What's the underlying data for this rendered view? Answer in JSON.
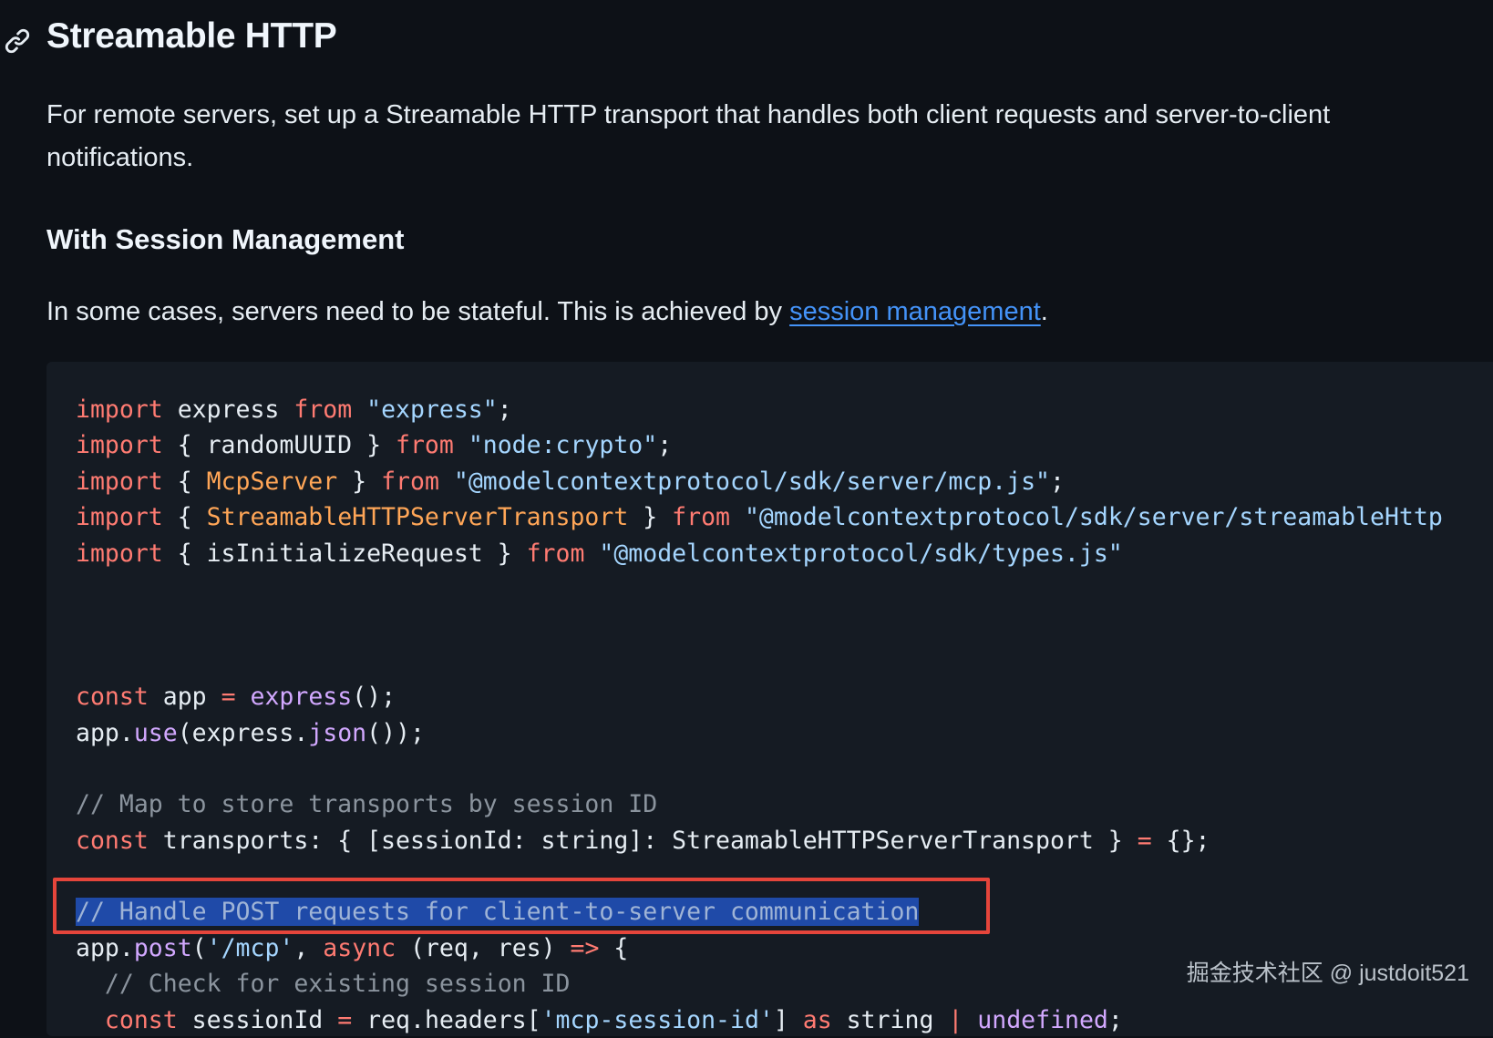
{
  "heading": "Streamable HTTP",
  "intro_line1": "For remote servers, set up a Streamable HTTP transport that handles both client requests and server-to-client",
  "intro_line2": "notifications.",
  "subheading": "With Session Management",
  "session_text_before": "In some cases, servers need to be stateful. This is achieved by ",
  "session_link": "session management",
  "session_text_after": ".",
  "code_lines": [
    [
      [
        "kw",
        "import"
      ],
      [
        "p",
        " express "
      ],
      [
        "kw",
        "from"
      ],
      [
        "p",
        " "
      ],
      [
        "str",
        "\"express\""
      ],
      [
        "p",
        ";"
      ]
    ],
    [
      [
        "kw",
        "import"
      ],
      [
        "p",
        " { randomUUID } "
      ],
      [
        "kw",
        "from"
      ],
      [
        "p",
        " "
      ],
      [
        "str",
        "\"node:crypto\""
      ],
      [
        "p",
        ";"
      ]
    ],
    [
      [
        "kw",
        "import"
      ],
      [
        "p",
        " { "
      ],
      [
        "cls",
        "McpServer"
      ],
      [
        "p",
        " } "
      ],
      [
        "kw",
        "from"
      ],
      [
        "p",
        " "
      ],
      [
        "str",
        "\"@modelcontextprotocol/sdk/server/mcp.js\""
      ],
      [
        "p",
        ";"
      ]
    ],
    [
      [
        "kw",
        "import"
      ],
      [
        "p",
        " { "
      ],
      [
        "cls",
        "StreamableHTTPServerTransport"
      ],
      [
        "p",
        " } "
      ],
      [
        "kw",
        "from"
      ],
      [
        "p",
        " "
      ],
      [
        "str",
        "\"@modelcontextprotocol/sdk/server/streamableHttp"
      ]
    ],
    [
      [
        "kw",
        "import"
      ],
      [
        "p",
        " { isInitializeRequest } "
      ],
      [
        "kw",
        "from"
      ],
      [
        "p",
        " "
      ],
      [
        "str",
        "\"@modelcontextprotocol/sdk/types.js\""
      ]
    ],
    [],
    [],
    [],
    [
      [
        "kw",
        "const"
      ],
      [
        "p",
        " app "
      ],
      [
        "kw",
        "="
      ],
      [
        "p",
        " "
      ],
      [
        "fn",
        "express"
      ],
      [
        "p",
        "();"
      ]
    ],
    [
      [
        "p",
        "app."
      ],
      [
        "fn",
        "use"
      ],
      [
        "p",
        "(express."
      ],
      [
        "fn",
        "json"
      ],
      [
        "p",
        "());"
      ]
    ],
    [],
    [
      [
        "cm",
        "// Map to store transports by session ID"
      ]
    ],
    [
      [
        "kw",
        "const"
      ],
      [
        "p",
        " transports: { [sessionId: string]: StreamableHTTPServerTransport } "
      ],
      [
        "kw",
        "="
      ],
      [
        "p",
        " {};"
      ]
    ],
    [],
    [
      [
        "sel",
        "// Handle POST requests for client-to-server communication"
      ]
    ],
    [
      [
        "p",
        "app."
      ],
      [
        "fn",
        "post"
      ],
      [
        "p",
        "("
      ],
      [
        "str",
        "'/mcp'"
      ],
      [
        "p",
        ", "
      ],
      [
        "kw",
        "async"
      ],
      [
        "p",
        " (req, res) "
      ],
      [
        "kw",
        "=>"
      ],
      [
        "p",
        " {"
      ]
    ],
    [
      [
        "p",
        "  "
      ],
      [
        "cm",
        "// Check for existing session ID"
      ]
    ],
    [
      [
        "p",
        "  "
      ],
      [
        "kw",
        "const"
      ],
      [
        "p",
        " sessionId "
      ],
      [
        "kw",
        "="
      ],
      [
        "p",
        " req.headers["
      ],
      [
        "str",
        "'mcp-session-id'"
      ],
      [
        "p",
        "] "
      ],
      [
        "kw",
        "as"
      ],
      [
        "p",
        " string "
      ],
      [
        "kw",
        "|"
      ],
      [
        "p",
        " "
      ],
      [
        "fn",
        "undefined"
      ],
      [
        "p",
        ";"
      ]
    ]
  ],
  "watermark": "掘金技术社区 @ justdoit521"
}
